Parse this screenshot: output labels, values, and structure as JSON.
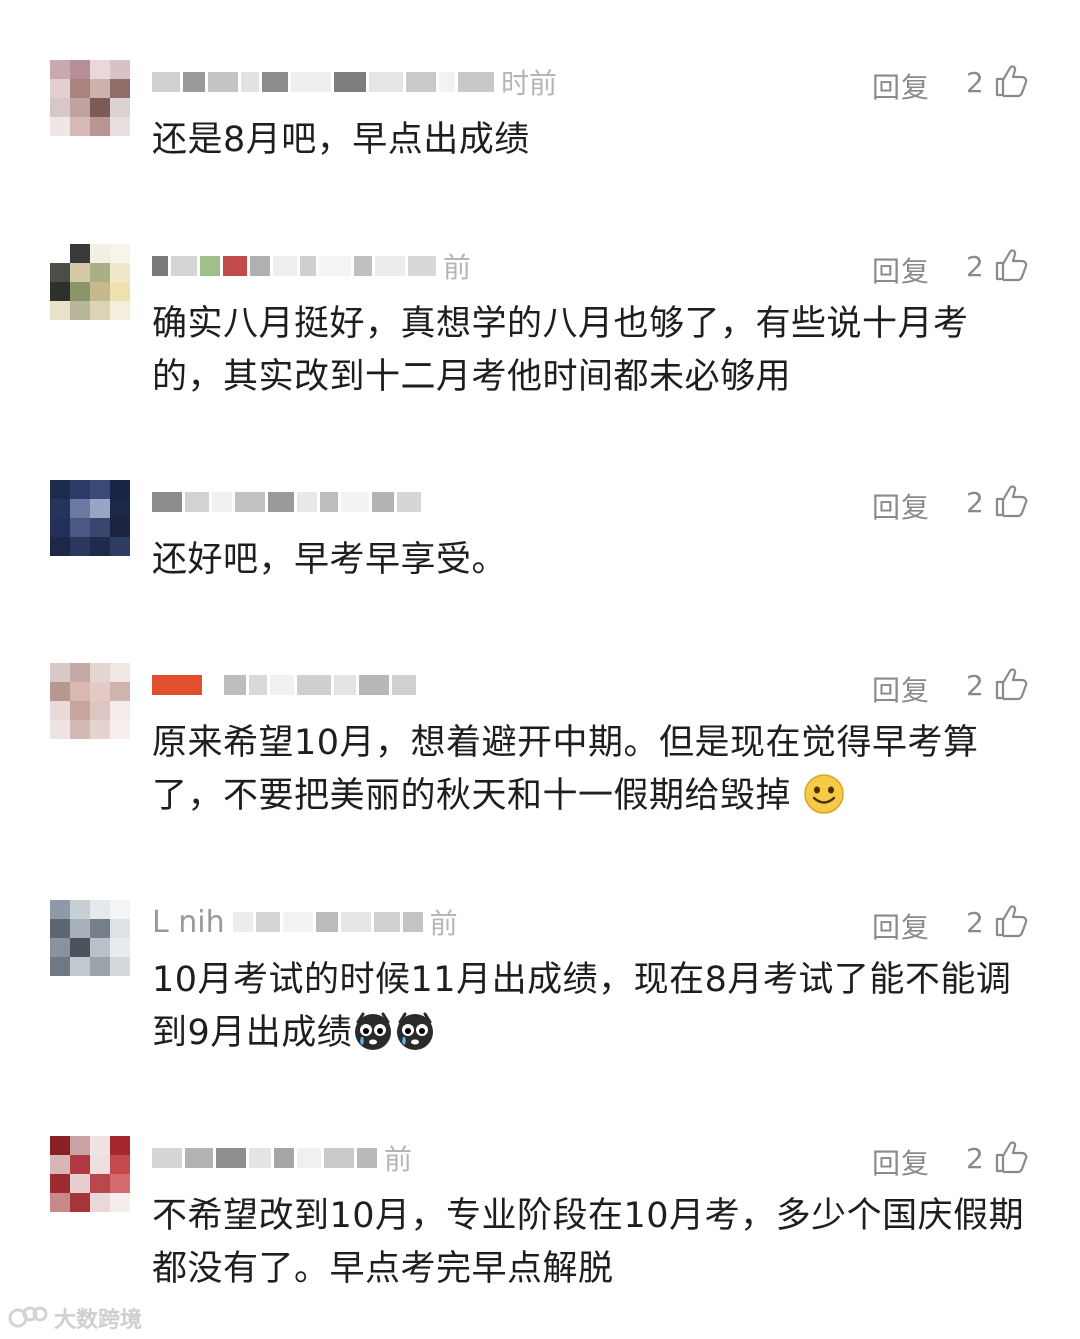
{
  "comments": [
    {
      "time": "时前",
      "reply_label": "回复",
      "likes": "2",
      "text": "还是8月吧，早点出成绩",
      "emojis": []
    },
    {
      "time": "前",
      "reply_label": "回复",
      "likes": "2",
      "text": "确实八月挺好，真想学的八月也够了，有些说十月考的，其实改到十二月考他时间都未必够用",
      "emojis": []
    },
    {
      "time": "",
      "reply_label": "回复",
      "likes": "2",
      "text": "还好吧，早考早享受。",
      "emojis": []
    },
    {
      "time": "",
      "reply_label": "回复",
      "likes": "2",
      "text": "原来希望10月，想着避开中期。但是现在觉得早考算了，不要把美丽的秋天和十一假期给毁掉",
      "emojis": [
        "smile-emoji"
      ]
    },
    {
      "time": "前",
      "name_visible": "L  nih",
      "reply_label": "回复",
      "likes": "2",
      "text": "10月考试的时候11月出成绩，现在8月考试了能不能调到9月出成绩",
      "emojis": [
        "crying-face-emoji",
        "crying-face-emoji"
      ]
    },
    {
      "time": "前",
      "reply_label": "回复",
      "likes": "2",
      "text": "不希望改到10月，专业阶段在10月考，多少个国庆假期都没有了。早点考完早点解脱",
      "emojis": []
    }
  ],
  "watermark": "大数跨境",
  "colors": {
    "meta_text": "#8a8a8a",
    "time_text": "#b5b5b5",
    "body_text": "#1e1e1e"
  }
}
